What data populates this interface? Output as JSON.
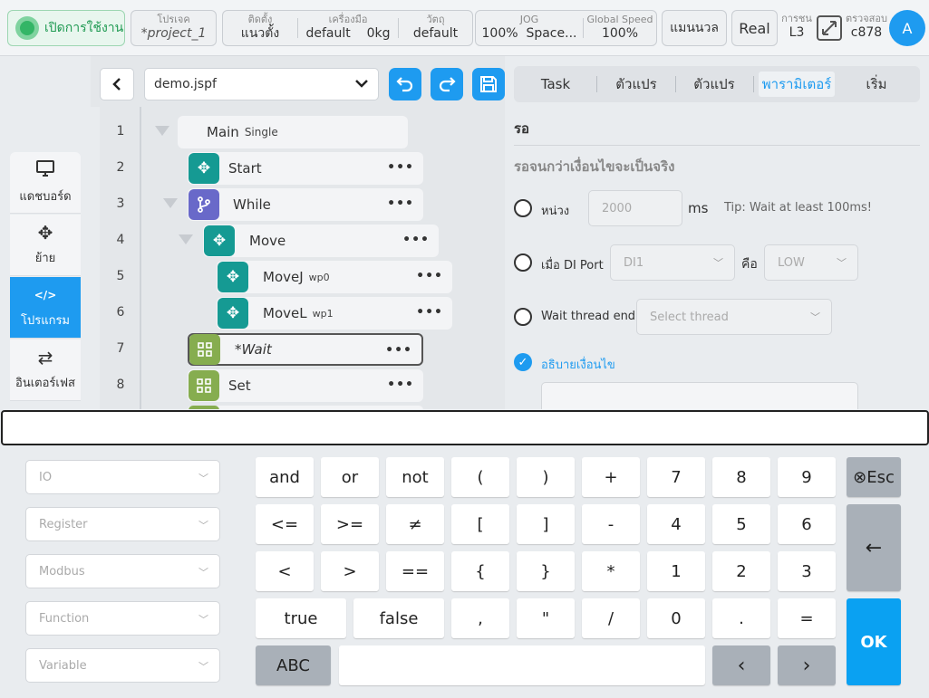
{
  "topbar": {
    "enable_label": "เปิดการใช้งาน",
    "project": {
      "key": "โปรเจค",
      "value": "*project_1"
    },
    "install": {
      "key": "ติดตั้ง",
      "value": "แนวตั้ง"
    },
    "tool": {
      "key": "เครื่องมือ",
      "value": "default",
      "extra": "0kg"
    },
    "object": {
      "key": "วัตถุ",
      "value": "default"
    },
    "jog": {
      "key": "JOG",
      "value": "100%",
      "mode": "Space..."
    },
    "speed": {
      "key": "Global Speed",
      "value": "100%"
    },
    "manual_label": "แมนนวล",
    "real_label": "Real",
    "collision": {
      "key": "การชน",
      "value": "L3"
    },
    "check": {
      "key": "ตรวจสอบ",
      "value": "c878"
    },
    "avatar": "A"
  },
  "leftnav": [
    {
      "label": "แดชบอร์ด",
      "icon": "monitor-icon",
      "glyph": "🖵"
    },
    {
      "label": "ย้าย",
      "icon": "move-icon",
      "glyph": "✥"
    },
    {
      "label": "โปรแกรม",
      "icon": "code-icon",
      "glyph": "</>"
    },
    {
      "label": "อินเตอร์เฟส",
      "icon": "interface-icon",
      "glyph": "⇄"
    }
  ],
  "program": {
    "file": "demo.jspf",
    "lines": [
      "1",
      "2",
      "3",
      "4",
      "5",
      "6",
      "7",
      "8"
    ],
    "nodes": [
      {
        "label": "Main",
        "sub": "Single"
      },
      {
        "label": "Start"
      },
      {
        "label": "While"
      },
      {
        "label": "Move"
      },
      {
        "label": "MoveJ",
        "sub": "wp0"
      },
      {
        "label": "MoveL",
        "sub": "wp1"
      },
      {
        "label": "*Wait"
      },
      {
        "label": "Set"
      }
    ]
  },
  "tabs": [
    "Task",
    "ตัวแปร",
    "ตัวแปร",
    "พารามิเตอร์",
    "เริ่ม"
  ],
  "params": {
    "title": "รอ",
    "subtitle": "รอจนกว่าเงื่อนไขจะเป็นจริง",
    "delay_label": "หน่วง",
    "delay_value": "2000",
    "delay_unit": "ms",
    "delay_tip": "Tip: Wait at least 100ms!",
    "di_label": "เมื่อ DI Port",
    "di_value": "DI1",
    "is_label": "คือ",
    "is_value": "LOW",
    "thread_label": "Wait thread end",
    "thread_placeholder": "Select thread",
    "cond_label": "อธิบายเงื่อนไข"
  },
  "keyboard": {
    "selects": [
      "IO",
      "Register",
      "Modbus",
      "Function",
      "Variable"
    ],
    "row1": [
      "and",
      "or",
      "not",
      "(",
      ")",
      "+",
      "7",
      "8",
      "9"
    ],
    "row2": [
      "<=",
      ">=",
      "≠",
      "[",
      "]",
      "-",
      "4",
      "5",
      "6"
    ],
    "row3": [
      "<",
      ">",
      "==",
      "{",
      "}",
      "*",
      "1",
      "2",
      "3"
    ],
    "row4": [
      "true",
      "false",
      ",",
      "\"",
      "/",
      "0",
      ".",
      "="
    ],
    "abc": "ABC",
    "esc": "⊗Esc",
    "backspace": "←",
    "ok": "OK",
    "left": "‹",
    "right": "›"
  }
}
